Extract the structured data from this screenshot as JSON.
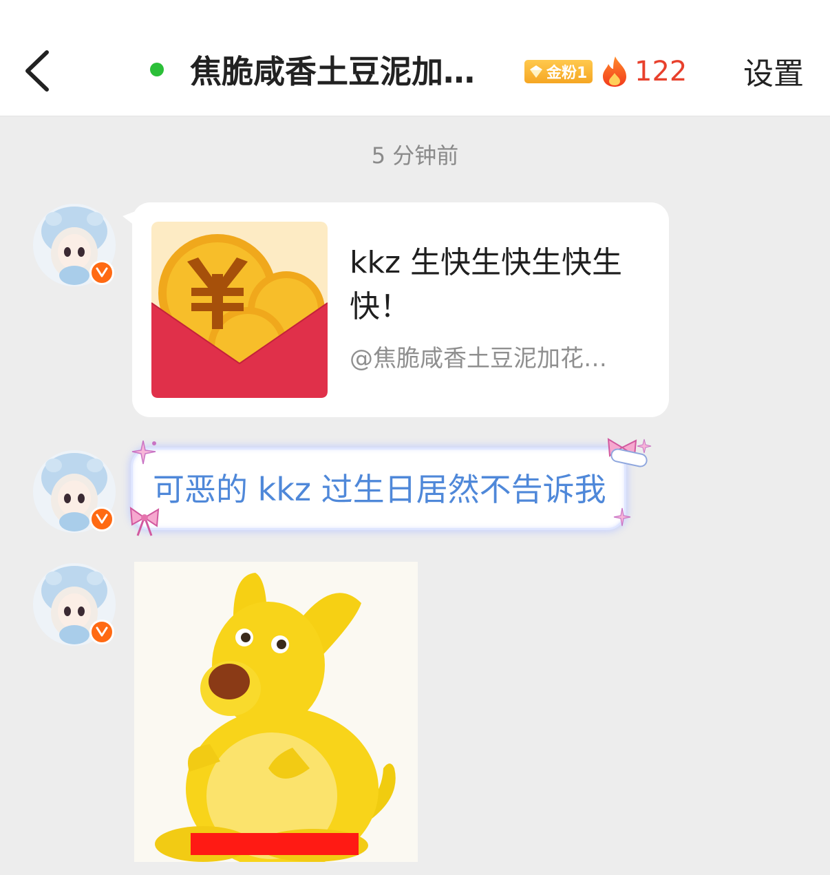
{
  "header": {
    "title": "焦脆咸香土豆泥加…",
    "fan_badge": "金粉1",
    "fire_count": "122",
    "settings_label": "设置"
  },
  "timestamp": "5 分钟前",
  "messages": [
    {
      "type": "red_packet",
      "text": "kkz 生快生快生快生快！",
      "from": "@焦脆咸香土豆泥加花…"
    },
    {
      "type": "text",
      "text": "可恶的 kkz 过生日居然不告诉我"
    },
    {
      "type": "image"
    }
  ],
  "colors": {
    "online": "#2bbf38",
    "fire": "#e8402c",
    "bubble_text": "#4f88d9",
    "badge": "#f5a623",
    "verified": "#ff6a13",
    "envelope": "#e0304a"
  }
}
